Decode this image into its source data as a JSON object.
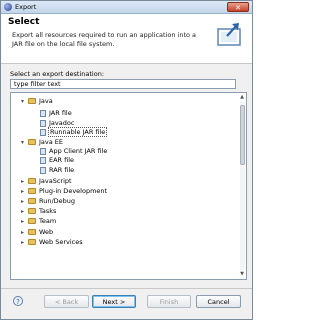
{
  "window": {
    "title": "Export",
    "close_label": "✕"
  },
  "header": {
    "title": "Select",
    "description": "Export all resources required to run an application into a JAR file on the local file system."
  },
  "destination": {
    "label": "Select an export destination:",
    "filter_placeholder": "type filter text"
  },
  "tree": {
    "items": [
      {
        "label": "Java",
        "type": "folder",
        "expanded": true
      },
      {
        "label": "JAR file",
        "type": "file"
      },
      {
        "label": "Javadoc",
        "type": "file"
      },
      {
        "label": "Runnable JAR file",
        "type": "file",
        "selected": true
      },
      {
        "label": "Java EE",
        "type": "folder",
        "expanded": true
      },
      {
        "label": "App Client JAR file",
        "type": "file"
      },
      {
        "label": "EAR file",
        "type": "file"
      },
      {
        "label": "RAR file",
        "type": "file"
      },
      {
        "label": "JavaScript",
        "type": "folder"
      },
      {
        "label": "Plug-in Development",
        "type": "folder"
      },
      {
        "label": "Run/Debug",
        "type": "folder"
      },
      {
        "label": "Tasks",
        "type": "folder"
      },
      {
        "label": "Team",
        "type": "folder"
      },
      {
        "label": "Web",
        "type": "folder"
      },
      {
        "label": "Web Services",
        "type": "folder"
      }
    ]
  },
  "buttons": {
    "back": "< Back",
    "next": "Next >",
    "finish": "Finish",
    "cancel": "Cancel"
  },
  "help_label": "?"
}
